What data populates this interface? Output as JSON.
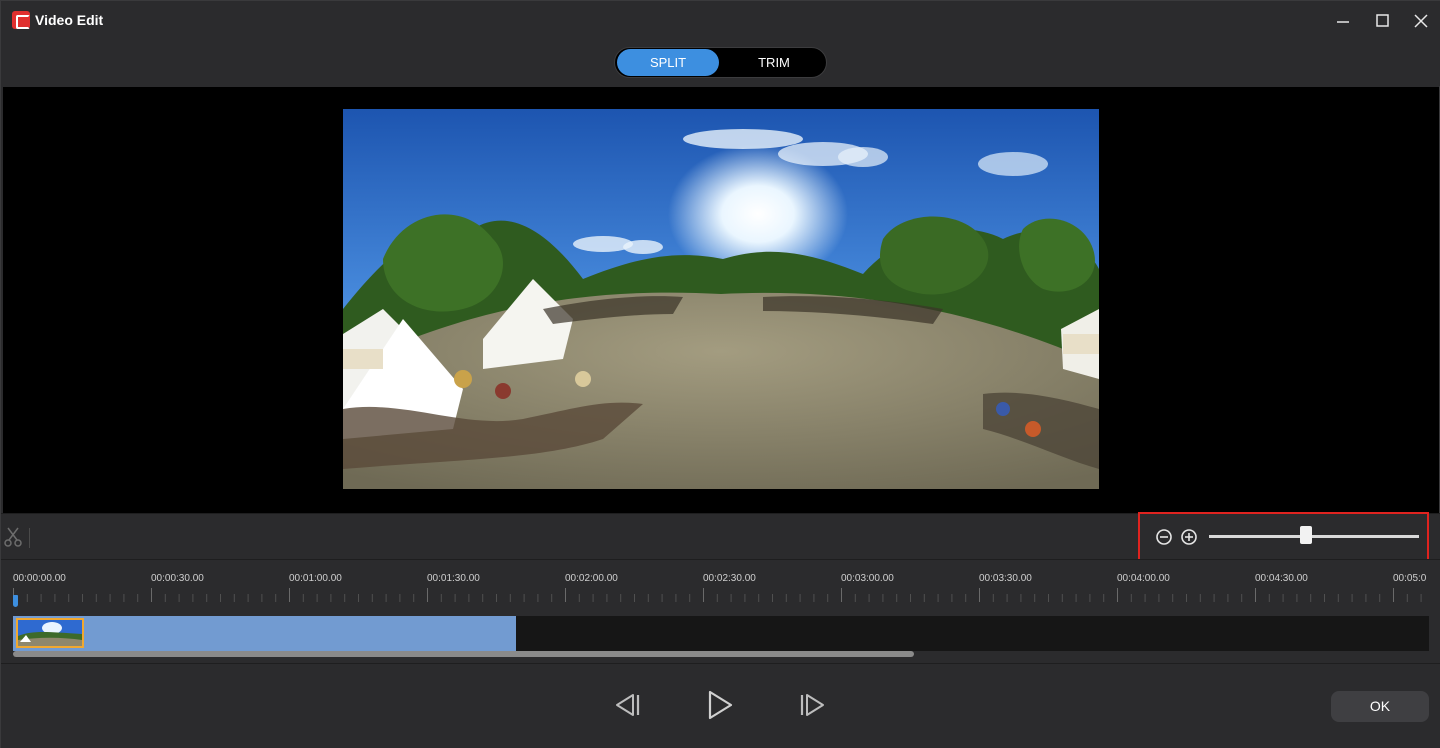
{
  "window": {
    "title": "Video Edit",
    "accent_color": "#3d8fe0",
    "highlight_color": "#e0231f"
  },
  "mode_tabs": [
    {
      "label": "SPLIT",
      "active": true
    },
    {
      "label": "TRIM",
      "active": false
    }
  ],
  "icons": {
    "app": "app-logo-icon",
    "minimize": "minimize-icon",
    "maximize": "maximize-icon",
    "close": "close-icon",
    "split": "scissors-icon",
    "zoom_out": "zoom-out-icon",
    "zoom_in": "zoom-in-icon",
    "previous": "previous-frame-icon",
    "play": "play-icon",
    "next": "next-frame-icon"
  },
  "zoom": {
    "level_fraction": 0.46
  },
  "timeline": {
    "tick_labels": [
      "00:00:00.00",
      "00:00:30.00",
      "00:01:00.00",
      "00:01:30.00",
      "00:02:00.00",
      "00:02:30.00",
      "00:03:00.00",
      "00:03:30.00",
      "00:04:00.00",
      "00:04:30.00",
      "00:05:0"
    ],
    "clip_end_fraction": 0.355,
    "scroll_fraction": 0.636
  },
  "footer": {
    "ok_label": "OK"
  }
}
